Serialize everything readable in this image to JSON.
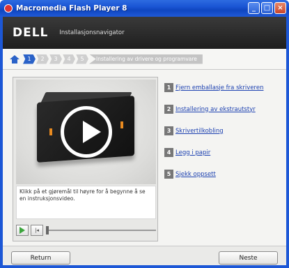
{
  "window": {
    "title": "Macromedia Flash Player 8"
  },
  "banner": {
    "logo": "DELL",
    "subtitle": "Installasjonsnavigator"
  },
  "breadcrumb": {
    "steps": [
      "1",
      "2",
      "3",
      "4",
      "5"
    ],
    "current_label": "Installering av drivere og programvare"
  },
  "video": {
    "caption": "Klikk på et gjøremål til høyre for å begynne å se en instruksjonsvideo."
  },
  "tasks": [
    {
      "num": "1",
      "label": "Fjern emballasje fra skriveren"
    },
    {
      "num": "2",
      "label": "Installering av ekstrautstyr"
    },
    {
      "num": "3",
      "label": "Skrivertilkobling"
    },
    {
      "num": "4",
      "label": "Legg i papir"
    },
    {
      "num": "5",
      "label": "Sjekk oppsett"
    }
  ],
  "buttons": {
    "back": "Return",
    "next": "Neste"
  },
  "colors": {
    "titlebar": "#1a55d4",
    "accent": "#2a62c8",
    "link": "#1a3fb0",
    "play": "#3ca53c"
  }
}
